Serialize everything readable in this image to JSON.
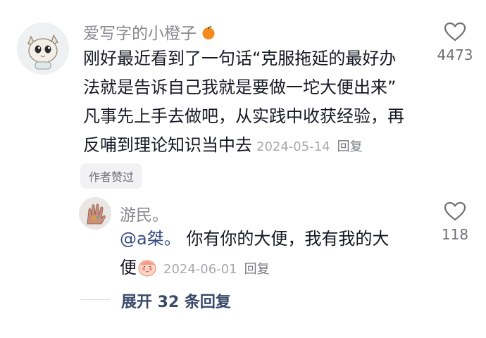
{
  "comment": {
    "username": "爱写字的小橙子",
    "user_emoji_icon": "orange-emoji-icon",
    "text_lines": [
      "刚好最近看到了一句话“克服拖延的最好办",
      "法就是告诉自己我就是要做一坨大便出来”",
      "凡事先上手去做吧，从实践中收获经验，再",
      "反哺到理论知识当中去"
    ],
    "date": "2024-05-14",
    "reply_label": "回复",
    "like_count": "4473",
    "author_liked_label": "作者赞过"
  },
  "reply": {
    "username": "游民。",
    "mention": "@a桀。",
    "text_line1": " 你有你的大便，我有我的大",
    "text_line2": "便",
    "emoji_icon": "blushing-face-emoji-icon",
    "date": "2024-06-01",
    "reply_label": "回复",
    "like_count": "118"
  },
  "expand": {
    "label": "展开 32 条回复"
  }
}
